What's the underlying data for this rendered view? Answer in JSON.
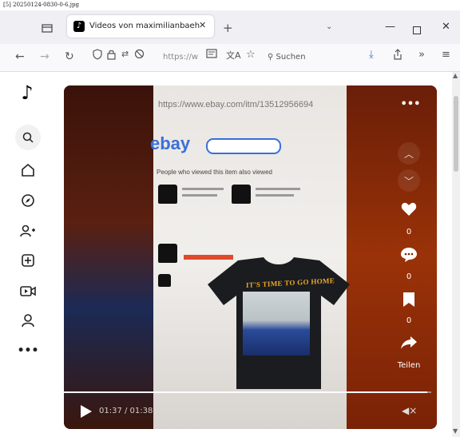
{
  "file_caption": "[5] 20250124-0830-0-6.jpg",
  "browser": {
    "tab": {
      "title": "Videos von maximilianbaehring",
      "close": "✕",
      "favicon": "tiktok-icon"
    },
    "new_tab": "+",
    "all_tabs": "⌄",
    "window": {
      "minimize": "—",
      "close": "✕"
    },
    "nav": {
      "back": "←",
      "forward": "→",
      "reload": "↻"
    },
    "url_text": "https://w",
    "search_placeholder": "Suchen"
  },
  "video": {
    "overlay_url": "https://www.ebay.com/itm/13512956694",
    "ebay_logo": "ebay",
    "ebay_heading": "People who viewed this item also viewed",
    "shirt_slogan": "IT'S TIME TO GO HOME",
    "more": "•••",
    "like_count": "0",
    "comment_count": "0",
    "save_count": "0",
    "share_label": "Teilen",
    "time": "01:37 / 01:38",
    "progress": 0.99
  },
  "colors": {
    "accent": "#000000",
    "overlay_text": "#ffffff",
    "ebay_blue": "#3a6fd8"
  }
}
